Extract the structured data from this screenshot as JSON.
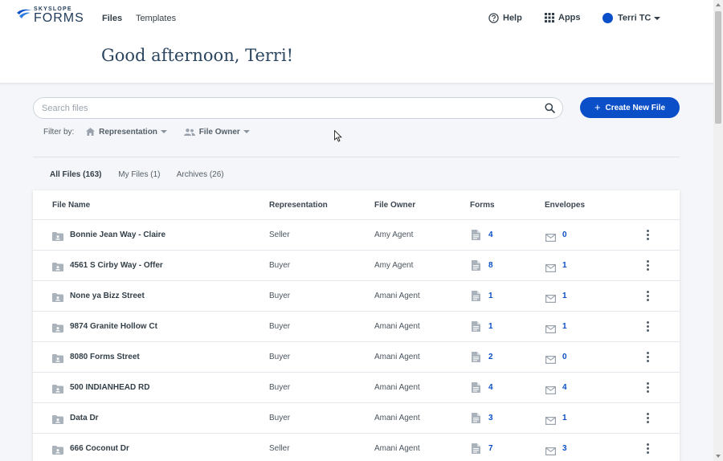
{
  "header": {
    "brand_small": "SKYSLOPE",
    "brand_big": "FORMS",
    "nav": [
      {
        "label": "Files",
        "active": true
      },
      {
        "label": "Templates",
        "active": false
      }
    ],
    "help_label": "Help",
    "apps_label": "Apps",
    "user_label": "Terri TC",
    "greeting": "Good afternoon, Terri!"
  },
  "search": {
    "placeholder": "Search files",
    "value": ""
  },
  "create_button_label": "Create New File",
  "filter": {
    "label": "Filter by:",
    "representation_label": "Representation",
    "owner_label": "File Owner"
  },
  "tabs": [
    {
      "label": "All Files (163)",
      "active": true
    },
    {
      "label": "My Files (1)",
      "active": false
    },
    {
      "label": "Archives (26)",
      "active": false
    }
  ],
  "table": {
    "columns": [
      "File Name",
      "Representation",
      "File Owner",
      "Forms",
      "Envelopes"
    ],
    "rows": [
      {
        "name": "Bonnie Jean Way - Claire",
        "representation": "Seller",
        "owner": "Amy Agent",
        "forms": "4",
        "envelopes": "0"
      },
      {
        "name": "4561 S Cirby Way - Offer",
        "representation": "Buyer",
        "owner": "Amy Agent",
        "forms": "8",
        "envelopes": "1"
      },
      {
        "name": "None ya Bizz Street",
        "representation": "Buyer",
        "owner": "Amani Agent",
        "forms": "1",
        "envelopes": "1"
      },
      {
        "name": "9874 Granite Hollow Ct",
        "representation": "Buyer",
        "owner": "Amani Agent",
        "forms": "1",
        "envelopes": "1"
      },
      {
        "name": "8080 Forms Street",
        "representation": "Buyer",
        "owner": "Amani Agent",
        "forms": "2",
        "envelopes": "0"
      },
      {
        "name": "500 INDIANHEAD RD",
        "representation": "Buyer",
        "owner": "Amani Agent",
        "forms": "4",
        "envelopes": "4"
      },
      {
        "name": "Data Dr",
        "representation": "Buyer",
        "owner": "Amani Agent",
        "forms": "3",
        "envelopes": "1"
      },
      {
        "name": "666 Coconut Dr",
        "representation": "Seller",
        "owner": "Amani Agent",
        "forms": "7",
        "envelopes": "3"
      }
    ]
  },
  "colors": {
    "accent": "#0a4fc7",
    "text": "#333f48",
    "background": "#f4f6f9"
  }
}
